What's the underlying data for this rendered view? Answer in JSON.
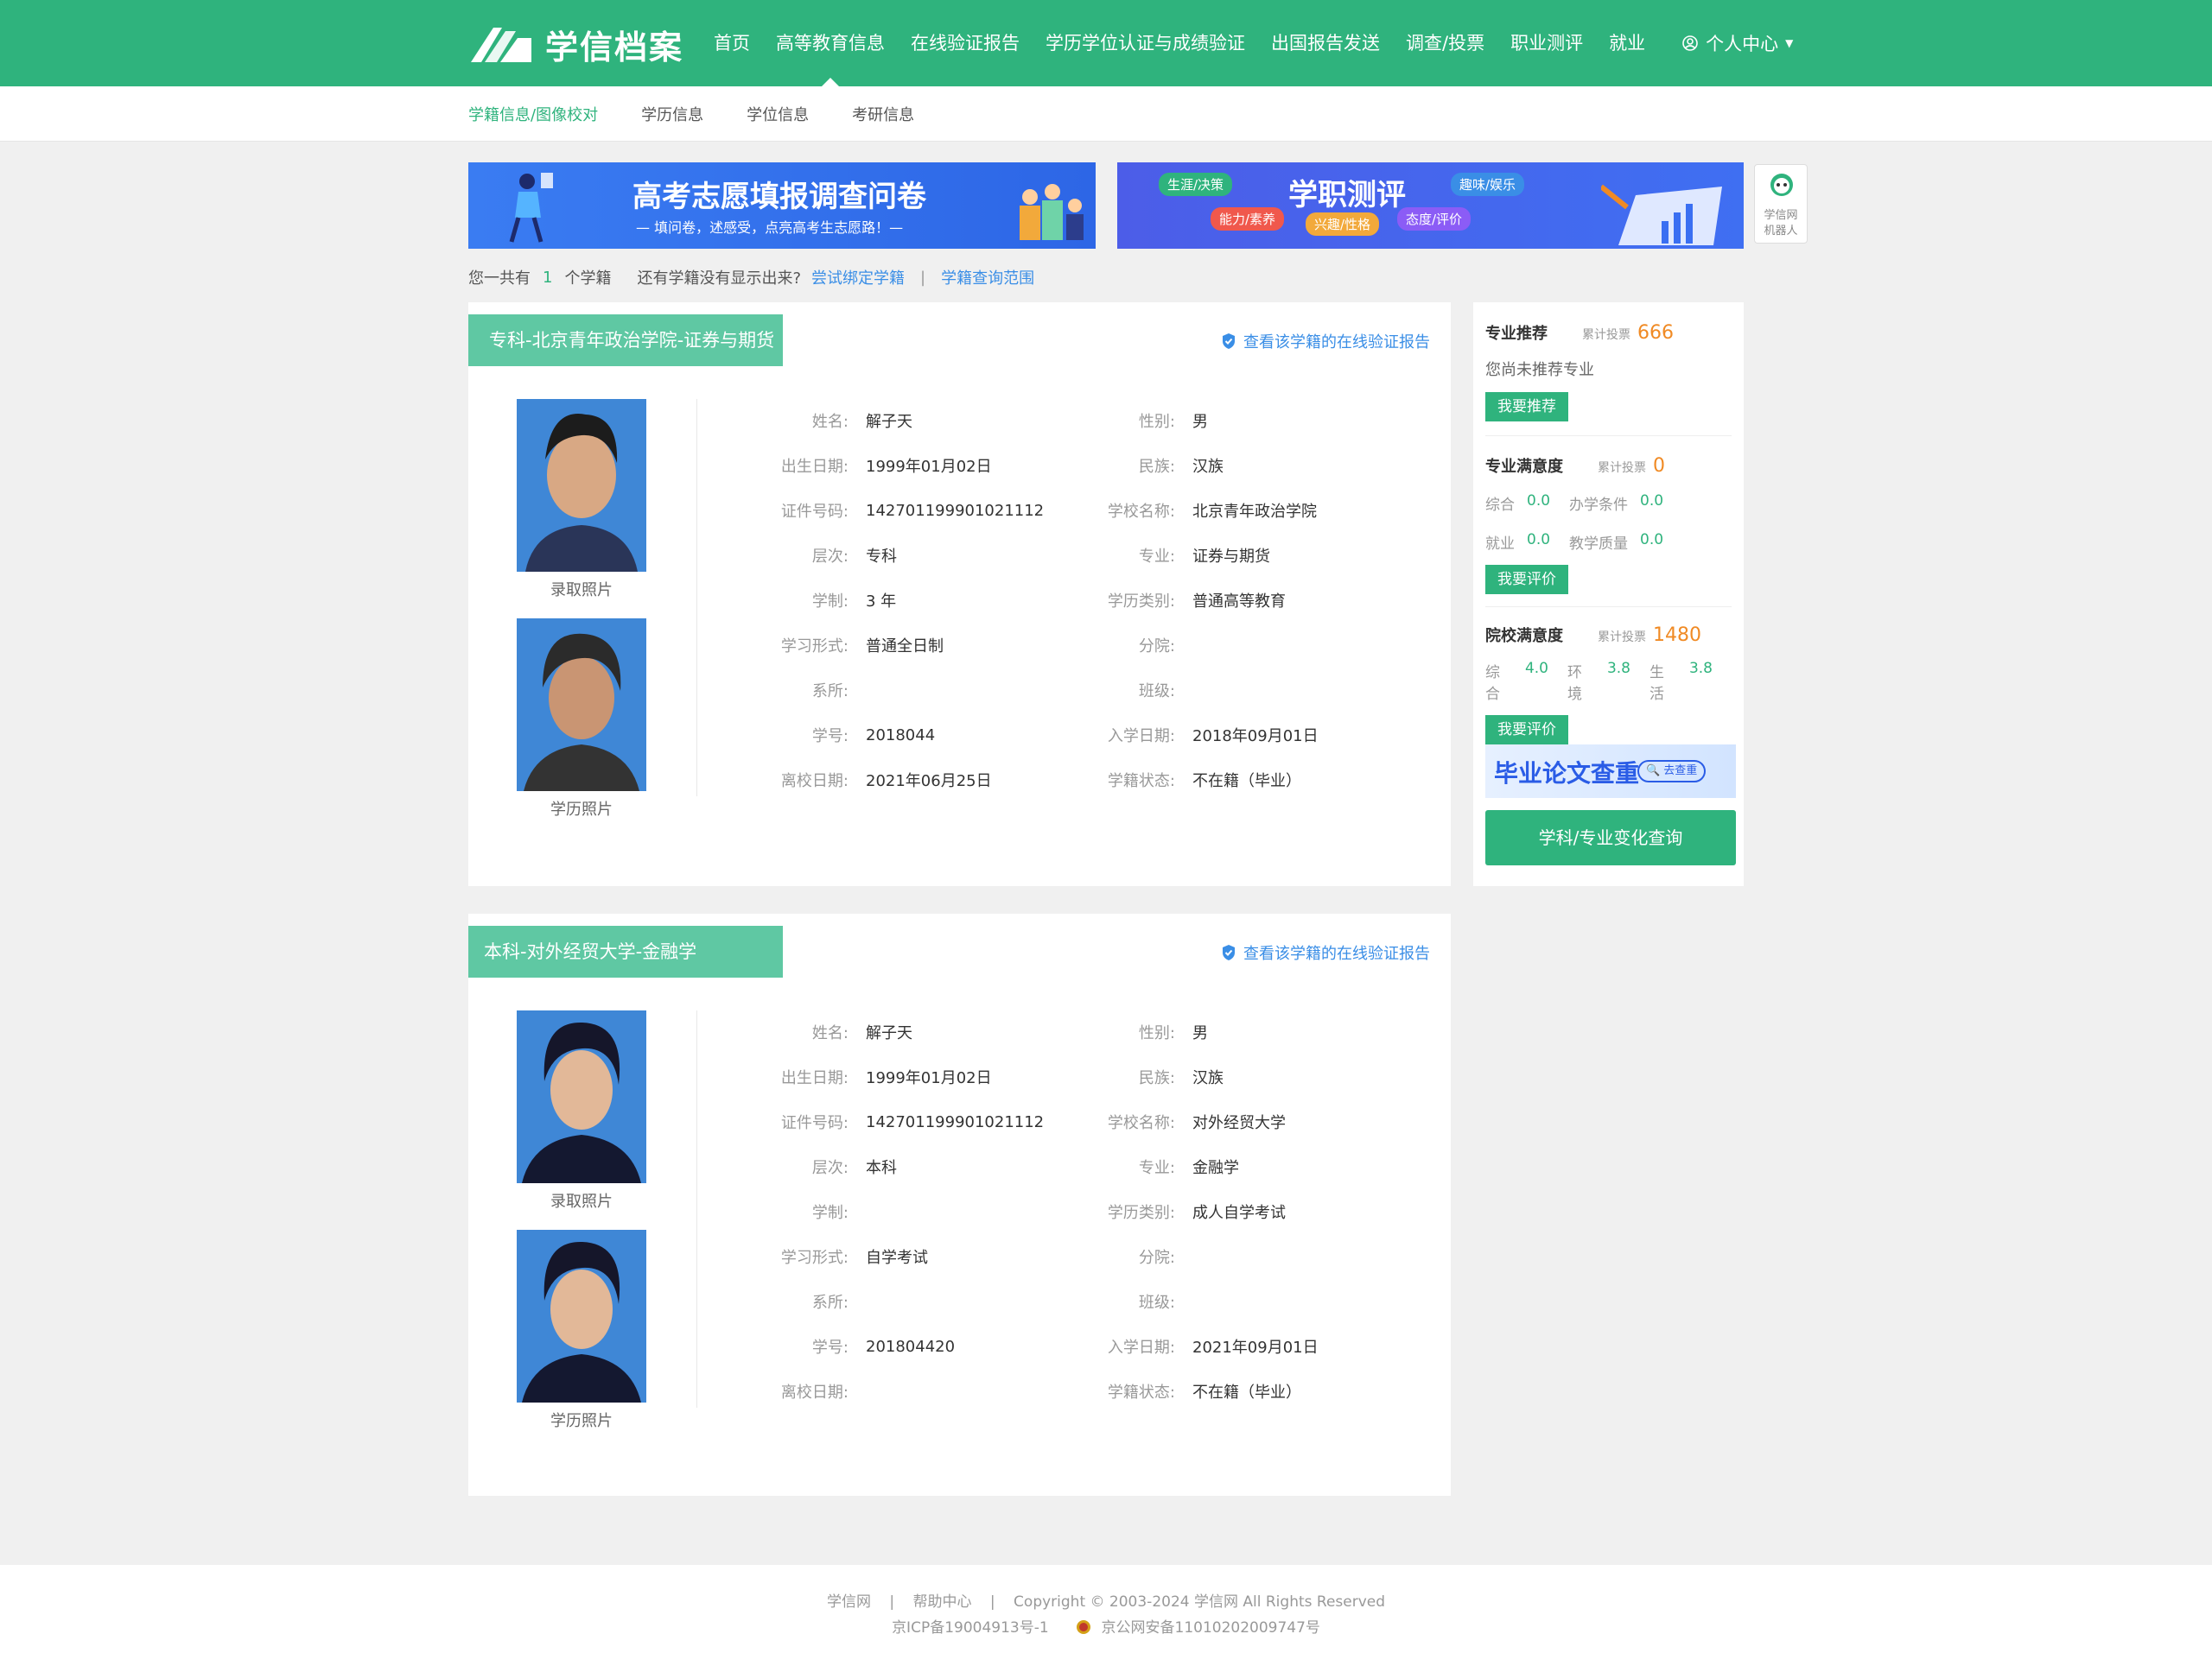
{
  "header": {
    "logo_text": "学信档案",
    "nav": [
      "首页",
      "高等教育信息",
      "在线验证报告",
      "学历学位认证与成绩验证",
      "出国报告发送",
      "调查/投票",
      "职业测评",
      "就业"
    ],
    "user_menu": "个人中心"
  },
  "subnav": [
    "学籍信息/图像校对",
    "学历信息",
    "学位信息",
    "考研信息"
  ],
  "banners": {
    "left": {
      "title": "高考志愿填报调查问卷",
      "subtitle": "— 填问卷，述感受，点亮高考生志愿路！—"
    },
    "right": {
      "title": "学职测评",
      "tags": [
        "生涯/决策",
        "能力/素养",
        "兴趣/性格",
        "态度/评价",
        "趣味/娱乐"
      ]
    },
    "robot_label": "学信网\n机器人"
  },
  "summary": {
    "prefix": "您一共有",
    "count": "1",
    "suffix": "个学籍",
    "question": "还有学籍没有显示出来?",
    "link1": "尝试绑定学籍",
    "sep": "|",
    "link2": "学籍查询范围"
  },
  "records": [
    {
      "tag": "专科-北京青年政治学院-证券与期货",
      "verify": "查看该学籍的在线验证报告",
      "photo1_caption": "录取照片",
      "photo2_caption": "学历照片",
      "fields": [
        {
          "label": "姓名:",
          "value": "解子天"
        },
        {
          "label": "性别:",
          "value": "男"
        },
        {
          "label": "出生日期:",
          "value": "1999年01月02日"
        },
        {
          "label": "民族:",
          "value": "汉族"
        },
        {
          "label": "证件号码:",
          "value": "142701199901021112"
        },
        {
          "label": "学校名称:",
          "value": "北京青年政治学院"
        },
        {
          "label": "层次:",
          "value": "专科"
        },
        {
          "label": "专业:",
          "value": "证券与期货"
        },
        {
          "label": "学制:",
          "value": "3 年"
        },
        {
          "label": "学历类别:",
          "value": "普通高等教育"
        },
        {
          "label": "学习形式:",
          "value": "普通全日制"
        },
        {
          "label": "分院:",
          "value": ""
        },
        {
          "label": "系所:",
          "value": ""
        },
        {
          "label": "班级:",
          "value": ""
        },
        {
          "label": "学号:",
          "value": "2018044"
        },
        {
          "label": "入学日期:",
          "value": "2018年09月01日"
        },
        {
          "label": "离校日期:",
          "value": "2021年06月25日"
        },
        {
          "label": "学籍状态:",
          "value": "不在籍（毕业）"
        }
      ]
    },
    {
      "tag": "本科-对外经贸大学-金融学",
      "verify": "查看该学籍的在线验证报告",
      "photo1_caption": "录取照片",
      "photo2_caption": "学历照片",
      "fields": [
        {
          "label": "姓名:",
          "value": "解子天"
        },
        {
          "label": "性别:",
          "value": "男"
        },
        {
          "label": "出生日期:",
          "value": "1999年01月02日"
        },
        {
          "label": "民族:",
          "value": "汉族"
        },
        {
          "label": "证件号码:",
          "value": "142701199901021112"
        },
        {
          "label": "学校名称:",
          "value": "对外经贸大学"
        },
        {
          "label": "层次:",
          "value": "本科"
        },
        {
          "label": "专业:",
          "value": "金融学"
        },
        {
          "label": "学制:",
          "value": ""
        },
        {
          "label": "学历类别:",
          "value": "成人自学考试"
        },
        {
          "label": "学习形式:",
          "value": "自学考试"
        },
        {
          "label": "分院:",
          "value": ""
        },
        {
          "label": "系所:",
          "value": ""
        },
        {
          "label": "班级:",
          "value": ""
        },
        {
          "label": "学号:",
          "value": "201804420"
        },
        {
          "label": "入学日期:",
          "value": "2021年09月01日"
        },
        {
          "label": "离校日期:",
          "value": ""
        },
        {
          "label": "学籍状态:",
          "value": "不在籍（毕业）"
        }
      ]
    }
  ],
  "sidebar": {
    "major_rec": {
      "title": "专业推荐",
      "sub": "累计投票",
      "num": "666",
      "text": "您尚未推荐专业",
      "btn": "我要推荐"
    },
    "major_sat": {
      "title": "专业满意度",
      "sub": "累计投票",
      "num": "0",
      "scores1": [
        {
          "k": "综合",
          "v": "0.0"
        },
        {
          "k": "办学条件",
          "v": "0.0"
        }
      ],
      "scores2": [
        {
          "k": "就业",
          "v": "0.0"
        },
        {
          "k": "教学质量",
          "v": "0.0"
        }
      ],
      "btn": "我要评价"
    },
    "school_sat": {
      "title": "院校满意度",
      "sub": "累计投票",
      "num": "1480",
      "scores": [
        {
          "k": "综合",
          "v": "4.0"
        },
        {
          "k": "环境",
          "v": "3.8"
        },
        {
          "k": "生活",
          "v": "3.8"
        }
      ],
      "btn": "我要评价"
    },
    "thesis_banner": {
      "title": "毕业论文查重",
      "btn": "去查重"
    },
    "big_btn": "学科/专业变化查询"
  },
  "footer": {
    "links": [
      "学信网",
      "帮助中心"
    ],
    "copyright": "Copyright © 2003-2024 学信网 All Rights Reserved",
    "icp": "京ICP备19004913号-1",
    "police": "京公网安备11010202009747号"
  },
  "colors": {
    "brand": "#2fb37d",
    "tag": "#5fc8a3",
    "link": "#3a8ee6",
    "accent": "#f08a24"
  }
}
